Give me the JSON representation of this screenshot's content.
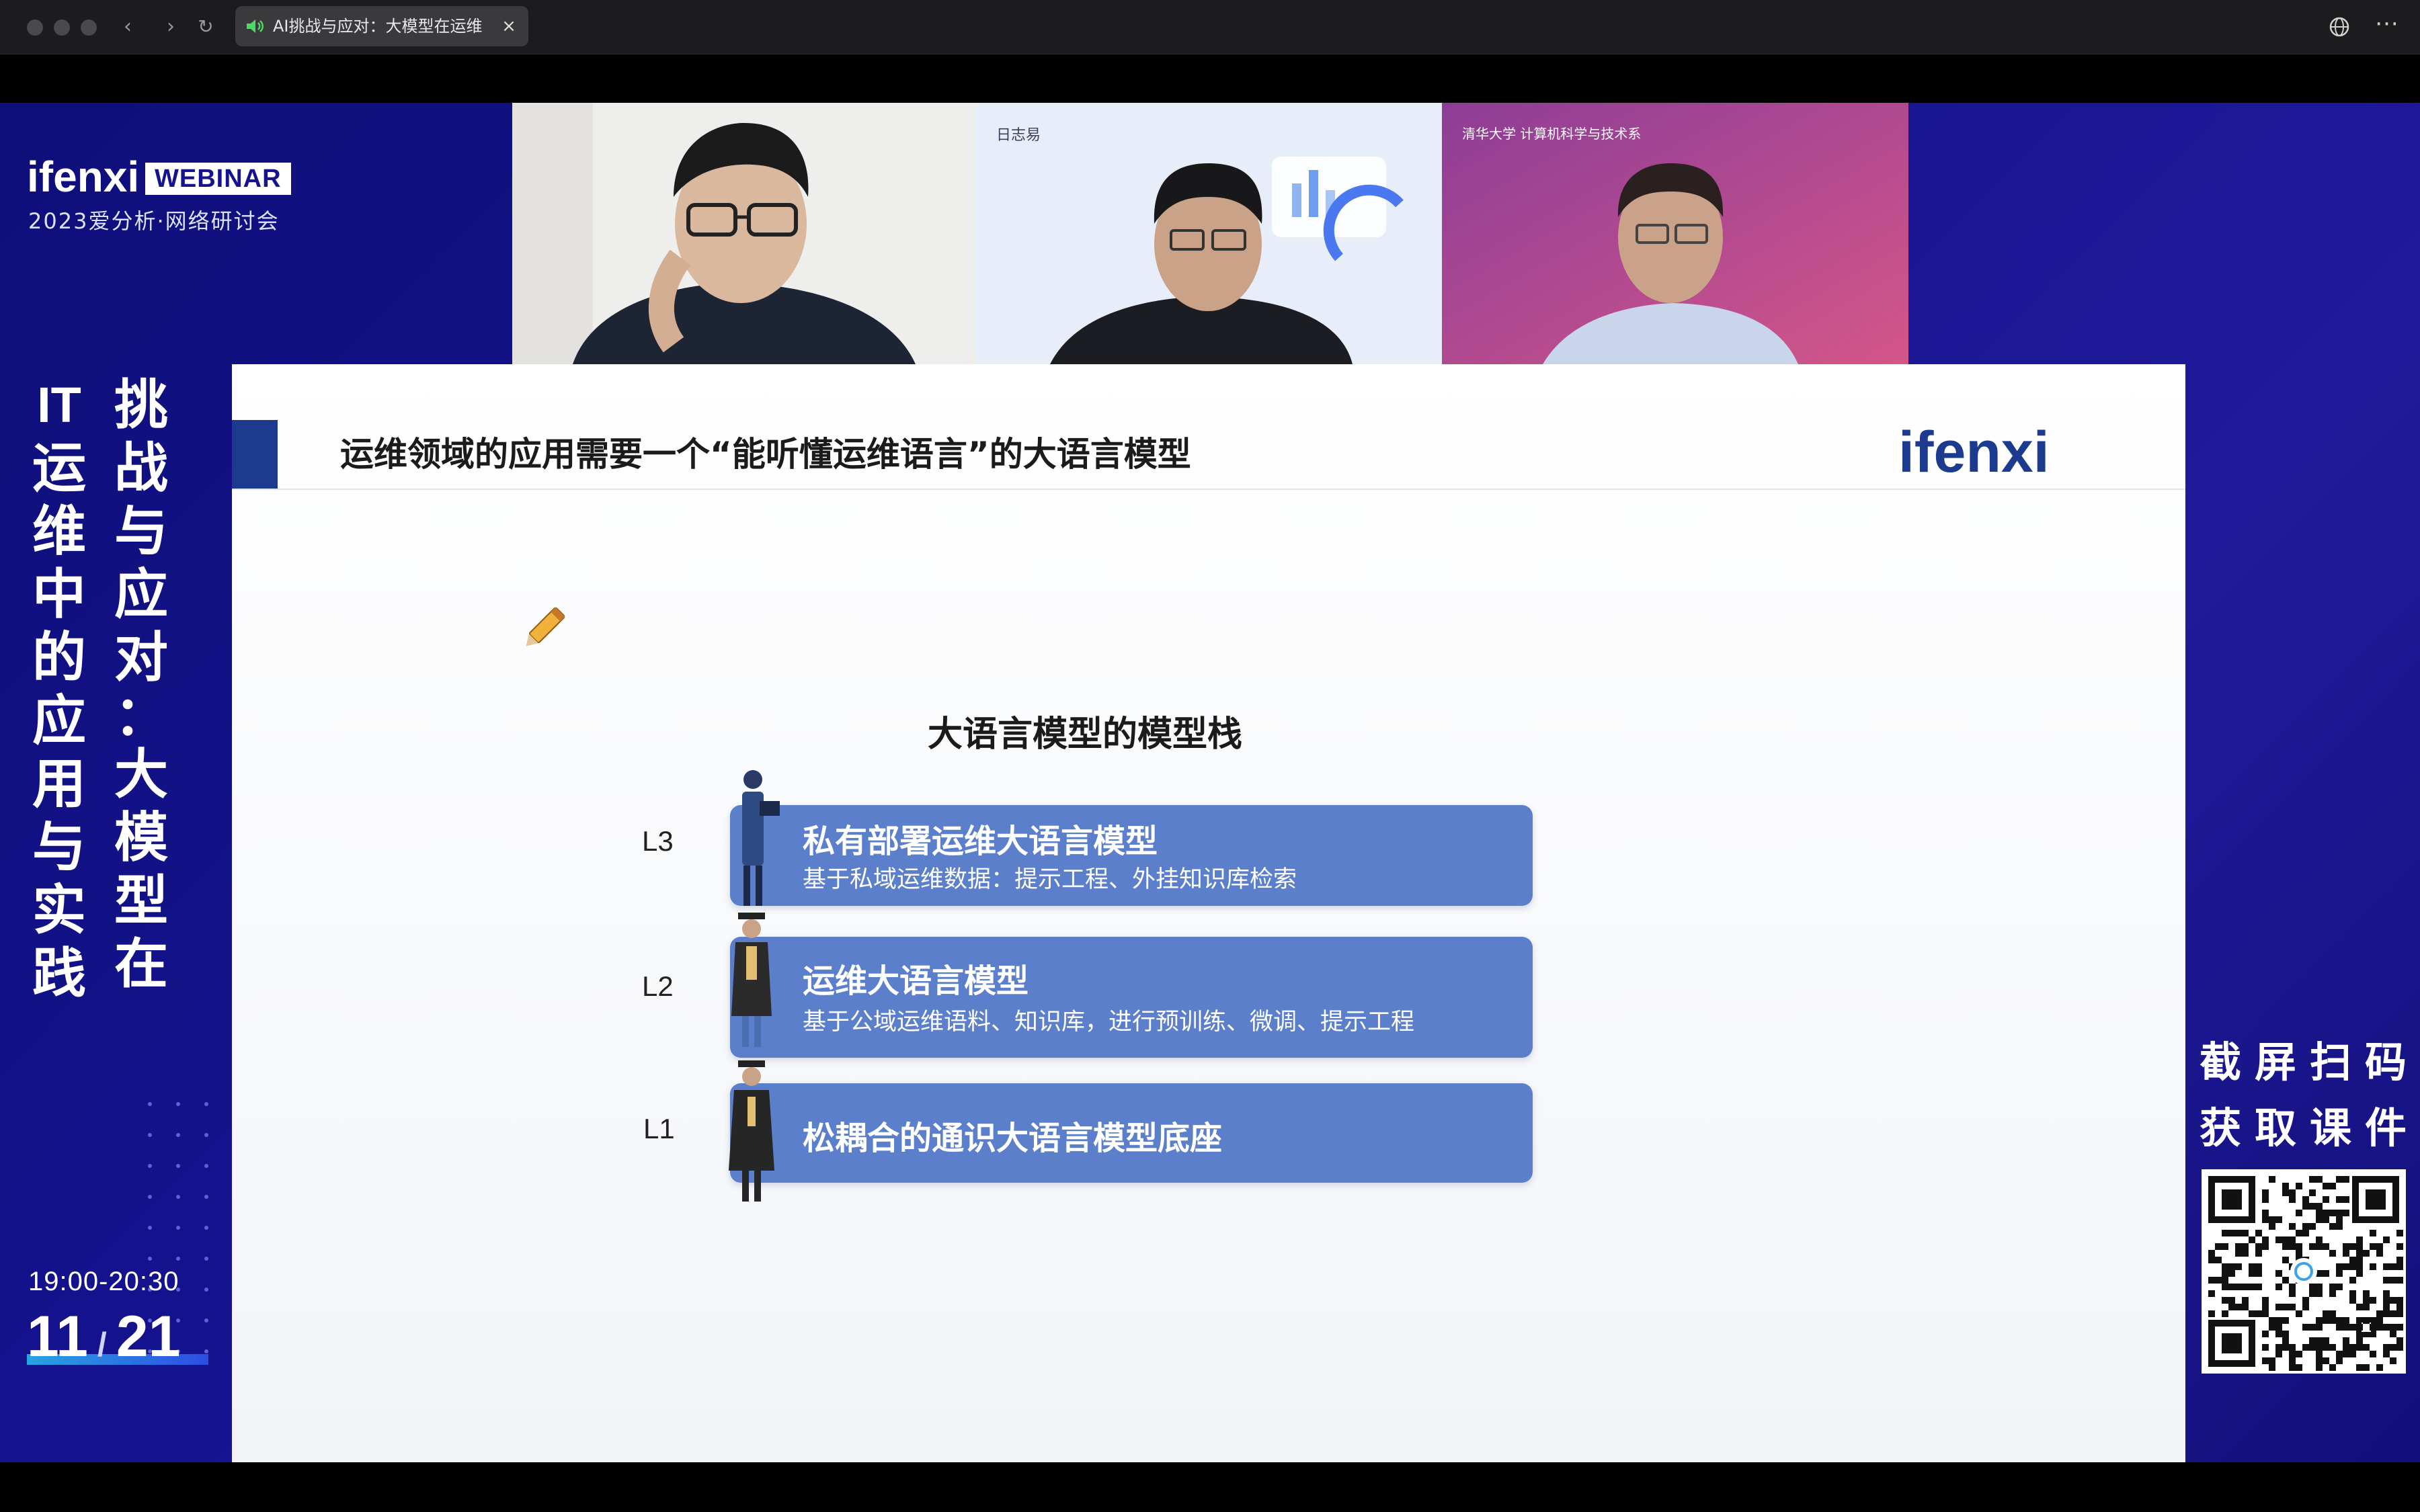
{
  "browser": {
    "tab_title": "AI挑战与应对：大模型在运维",
    "tab_close": "×",
    "nav_back": "‹",
    "nav_forward": "›",
    "nav_reload": "↻",
    "more": "···"
  },
  "event": {
    "brand": "ifenxi",
    "badge": "WEBINAR",
    "subtitle": "2023爱分析·网络研讨会",
    "title_col1": [
      "挑",
      "战",
      "与",
      "应",
      "对",
      "：",
      "大",
      "模",
      "型",
      "在"
    ],
    "title_col2": [
      "IT",
      "运",
      "维",
      "中",
      "的",
      "应",
      "用",
      "与",
      "实",
      "践"
    ],
    "time": "19:00-20:30",
    "date_month": "11",
    "date_sep": "/",
    "date_day": "21"
  },
  "participants": [
    {
      "name": "speaker-1",
      "bg": "#f1f1ef"
    },
    {
      "name": "speaker-2",
      "bg": "#e6edf8",
      "logo": "日志易"
    },
    {
      "name": "speaker-3",
      "bg": "#b0418f",
      "logo": "清华大学 计算机科学与技术系"
    }
  ],
  "slide": {
    "title": "运维领域的应用需要一个“能听懂运维语言”的大语言模型",
    "logo": "ifenxi",
    "stack_title": "大语言模型的模型栈",
    "levels": [
      {
        "label": "L3",
        "main": "私有部署运维大语言模型",
        "sub": "基于私域运维数据：提示工程、外挂知识库检索"
      },
      {
        "label": "L2",
        "main": "运维大语言模型",
        "sub": "基于公域运维语料、知识库，进行预训练、微调、提示工程"
      },
      {
        "label": "L1",
        "main": "松耦合的通识大语言模型底座",
        "sub": ""
      }
    ]
  },
  "qr_panel": {
    "caption_line1": "截屏扫码",
    "caption_line2": "获取课件"
  },
  "colors": {
    "stage_bg": "#15138f",
    "slide_accent": "#1c3b8f",
    "level_box": "#5b7fcb"
  }
}
